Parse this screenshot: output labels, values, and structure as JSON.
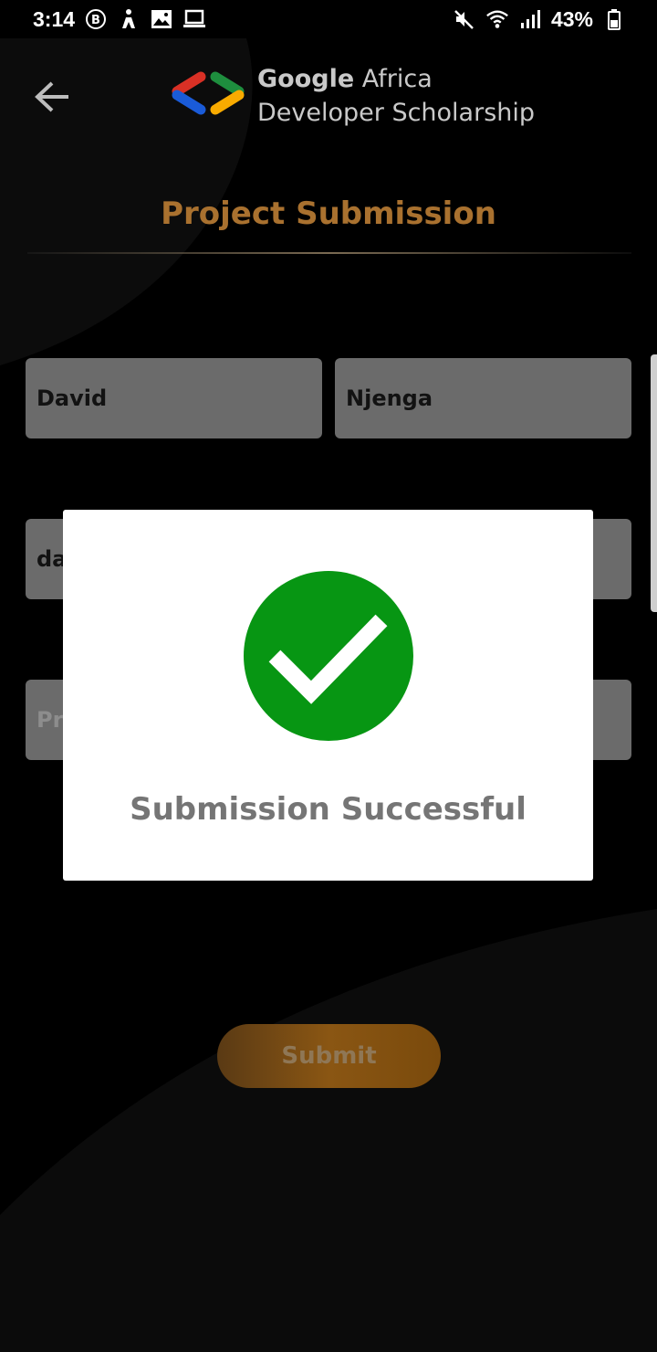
{
  "status_bar": {
    "time": "3:14",
    "battery": "43%",
    "left_icons": [
      "b-circle-icon",
      "accessibility-icon",
      "image-icon",
      "laptop-icon"
    ],
    "right_icons": [
      "mute-icon",
      "wifi-icon",
      "signal-icon",
      "battery-icon"
    ]
  },
  "header": {
    "back_icon": "arrow-left-icon",
    "logo_line1_bold": "Google",
    "logo_line1_rest": " Africa",
    "logo_line2": "Developer Scholarship"
  },
  "page_title": "Project Submission",
  "form": {
    "first_name": "David",
    "last_name": "Njenga",
    "email_visible": "da",
    "link_visible": "Pr",
    "submit_label": "Submit"
  },
  "modal": {
    "icon": "check-circle-icon",
    "message": "Submission Successful"
  },
  "colors": {
    "accent": "#a9712f",
    "success": "#079613",
    "button": "#8a5613"
  }
}
